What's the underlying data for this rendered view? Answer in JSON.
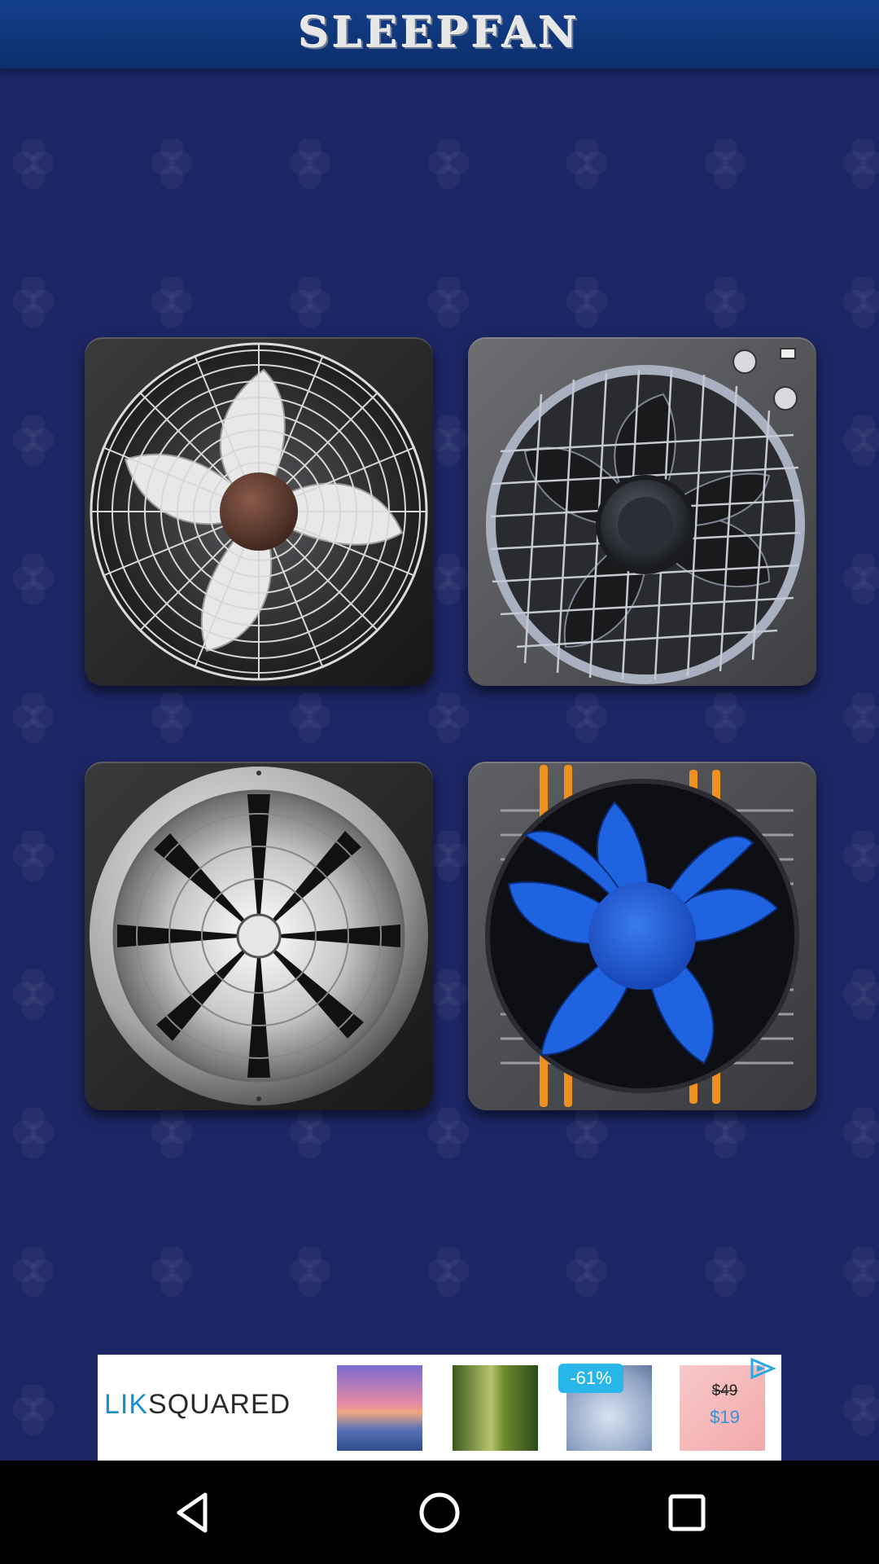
{
  "app": {
    "title": "SLEEPFAN"
  },
  "fans": [
    {
      "id": "fan-industrial",
      "icon": "industrial-fan-icon"
    },
    {
      "id": "fan-box",
      "icon": "box-fan-icon"
    },
    {
      "id": "fan-chrome",
      "icon": "chrome-fan-icon"
    },
    {
      "id": "fan-cpu",
      "icon": "cpu-cooler-fan-icon"
    }
  ],
  "ad": {
    "brand_prefix": "LIK",
    "brand_suffix": "SQUARED",
    "discount": "-61%",
    "old_price": "$49",
    "new_price": "$19"
  },
  "navbar": {
    "items": [
      "back",
      "home",
      "recents"
    ]
  },
  "colors": {
    "background": "#1c2664",
    "header": "#0c2e6c",
    "cpu_fan_blue": "#1f63e0",
    "cpu_fan_pipes": "#f0901e"
  }
}
